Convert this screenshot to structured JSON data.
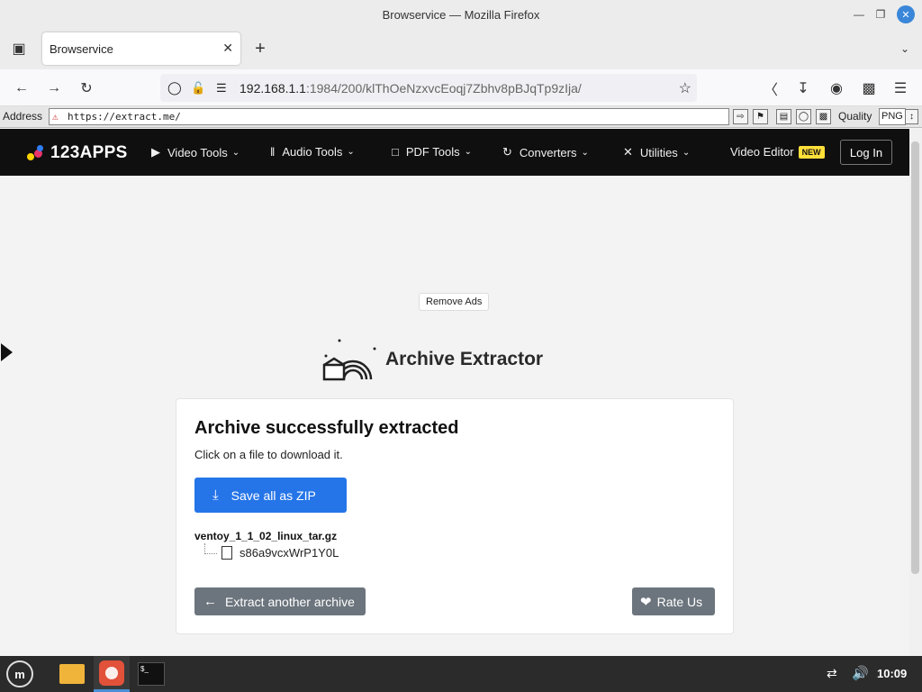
{
  "window": {
    "title": "Browservice — Mozilla Firefox"
  },
  "tab": {
    "title": "Browservice"
  },
  "urlbar": {
    "host": "192.168.1.1",
    "path": ":1984/200/klThOeNzxvcEoqj7Zbhv8pBJqTp9zIja/"
  },
  "addressbar": {
    "label": "Address",
    "url": "https://extract.me/",
    "quality_label": "Quality",
    "format": "PNG"
  },
  "site": {
    "logo": "123APPS",
    "nav": [
      {
        "label": "Video Tools",
        "icon": "play-circle-icon"
      },
      {
        "label": "Audio Tools",
        "icon": "waveform-icon"
      },
      {
        "label": "PDF Tools",
        "icon": "document-icon"
      },
      {
        "label": "Converters",
        "icon": "refresh-icon"
      },
      {
        "label": "Utilities",
        "icon": "tools-icon"
      }
    ],
    "video_editor": "Video Editor",
    "new_badge": "NEW",
    "login": "Log In",
    "remove_ads": "Remove Ads",
    "app_title": "Archive Extractor"
  },
  "card": {
    "heading": "Archive successfully extracted",
    "subtext": "Click on a file to download it.",
    "save_zip": "Save all as ZIP",
    "archive_name": "ventoy_1_1_02_linux_tar.gz",
    "file_name": "s86a9vcxWrP1Y0L",
    "extract_another": "Extract another archive",
    "rate_us": "Rate Us"
  },
  "taskbar": {
    "clock": "10:09"
  },
  "colors": {
    "primary": "#2575e8",
    "secondary_btn": "#6c757d",
    "nav_bg": "#0f0f0f",
    "badge": "#ffe03a"
  }
}
